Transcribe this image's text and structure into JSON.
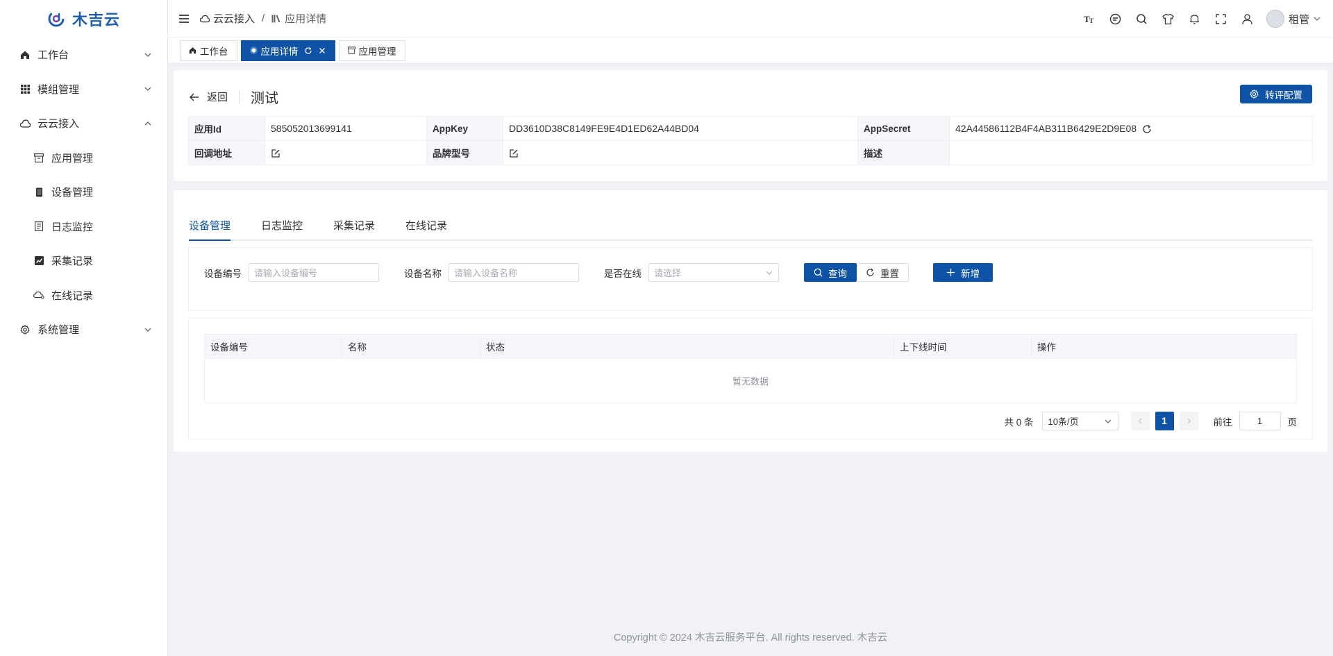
{
  "brand": {
    "name": "木吉云"
  },
  "sidebar": {
    "items": [
      {
        "label": "工作台",
        "icon": "home-icon",
        "expandable": true
      },
      {
        "label": "模组管理",
        "icon": "grid-icon",
        "expandable": true
      },
      {
        "label": "云云接入",
        "icon": "cloud-icon",
        "expandable": true,
        "expanded": true,
        "children": [
          {
            "label": "应用管理",
            "icon": "archive-icon"
          },
          {
            "label": "设备管理",
            "icon": "device-icon"
          },
          {
            "label": "日志监控",
            "icon": "document-icon"
          },
          {
            "label": "采集记录",
            "icon": "chart-icon"
          },
          {
            "label": "在线记录",
            "icon": "cloud-online-icon"
          }
        ]
      },
      {
        "label": "系统管理",
        "icon": "gear-icon",
        "expandable": true
      }
    ]
  },
  "header": {
    "breadcrumb": [
      "云云接入",
      "应用详情"
    ],
    "breadcrumb_sep": "/",
    "tools": [
      "font-size-icon",
      "message-icon",
      "search-icon",
      "theme-shirt-icon",
      "bell-icon",
      "fullscreen-icon",
      "user-icon"
    ],
    "user": {
      "name": "租管"
    }
  },
  "tags": [
    {
      "label": "工作台",
      "active": false
    },
    {
      "label": "应用详情",
      "active": true
    },
    {
      "label": "应用管理",
      "active": false
    }
  ],
  "detail": {
    "back_label": "返回",
    "title": "测试",
    "config_button": "转评配置",
    "fields": {
      "app_id_label": "应用Id",
      "app_id": "585052013699141",
      "app_key_label": "AppKey",
      "app_key": "DD3610D38C8149FE9E4D1ED62A44BD04",
      "app_secret_label": "AppSecret",
      "app_secret": "42A44586112B4F4AB311B6429E2D9E08",
      "callback_label": "回调地址",
      "callback": "",
      "brand_label": "品牌型号",
      "brand": "",
      "desc_label": "描述",
      "desc": ""
    }
  },
  "tabs": [
    {
      "label": "设备管理",
      "active": true
    },
    {
      "label": "日志监控",
      "active": false
    },
    {
      "label": "采集记录",
      "active": false
    },
    {
      "label": "在线记录",
      "active": false
    }
  ],
  "filters": {
    "device_no_label": "设备编号",
    "device_no_placeholder": "请输入设备编号",
    "device_name_label": "设备名称",
    "device_name_placeholder": "请输入设备名称",
    "online_label": "是否在线",
    "online_placeholder": "请选择",
    "query_button": "查询",
    "reset_button": "重置",
    "add_button": "新增"
  },
  "table": {
    "columns": [
      "设备编号",
      "名称",
      "状态",
      "上下线时间",
      "操作"
    ],
    "empty_text": "暂无数据"
  },
  "pagination": {
    "total_text": "共 0 条",
    "page_size": "10条/页",
    "current_page": "1",
    "goto_label": "前往",
    "goto_value": "1",
    "page_suffix": "页"
  },
  "footer": {
    "text": "Copyright © 2024 木吉云服务平台. All rights reserved. 木吉云"
  },
  "colors": {
    "primary": "#0f53a6",
    "border": "#ebeef5",
    "header_bg": "#f5f7fa"
  }
}
